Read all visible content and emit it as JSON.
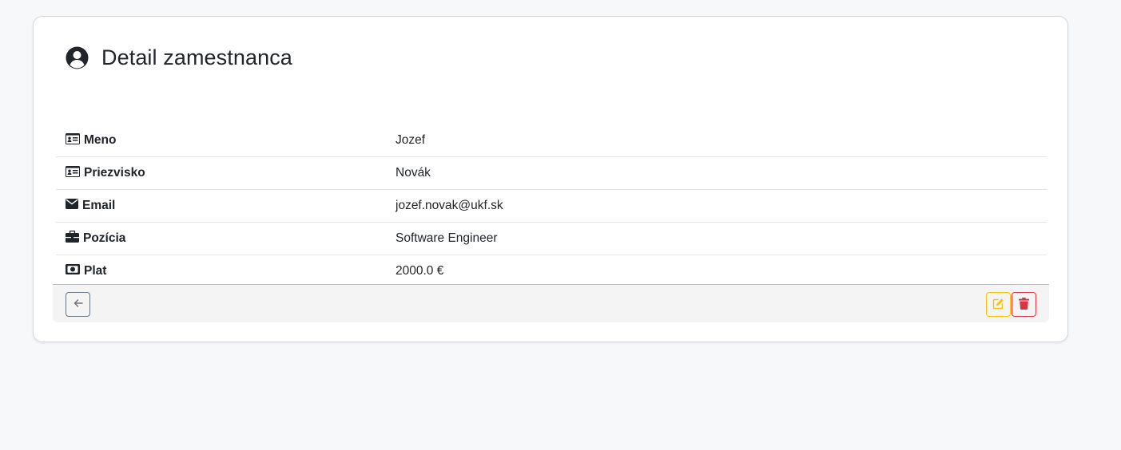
{
  "page": {
    "title": "Detail zamestnanca",
    "icon": "user-circle-icon"
  },
  "employee": {
    "rows": [
      {
        "label": "Meno",
        "value": "Jozef",
        "icon": "id-card-icon"
      },
      {
        "label": "Priezvisko",
        "value": "Novák",
        "icon": "id-card-icon"
      },
      {
        "label": "Email",
        "value": "jozef.novak@ukf.sk",
        "icon": "envelope-icon"
      },
      {
        "label": "Pozícia",
        "value": "Software Engineer",
        "icon": "briefcase-icon"
      },
      {
        "label": "Plat",
        "value": "2000.0 €",
        "icon": "money-bill-icon"
      }
    ]
  },
  "actions": {
    "back_icon": "arrow-left-icon",
    "edit_icon": "edit-icon",
    "delete_icon": "trash-icon"
  },
  "colors": {
    "edit": "#ffc107",
    "delete": "#dc3545",
    "back": "#6c757d",
    "text": "#212529"
  }
}
